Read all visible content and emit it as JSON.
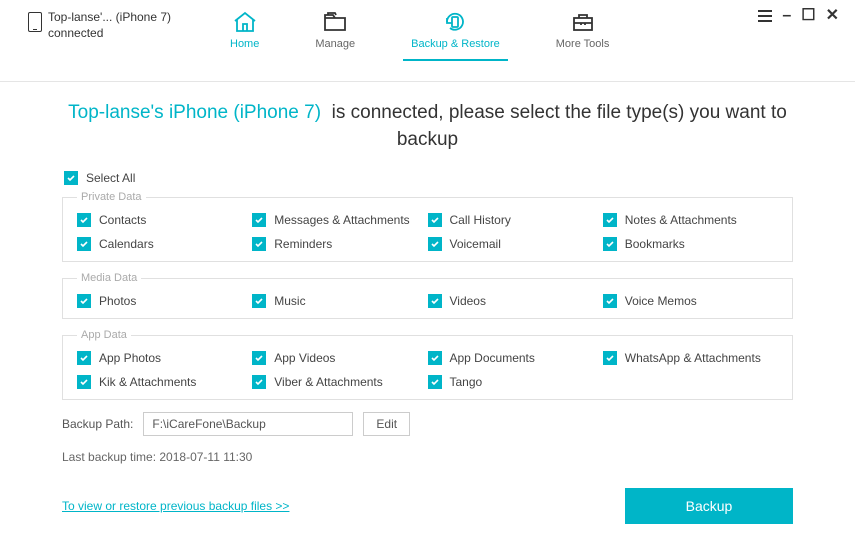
{
  "header": {
    "device_line1": "Top-lanse'... (iPhone 7)",
    "device_line2": "connected",
    "nav": {
      "home": "Home",
      "manage": "Manage",
      "backup": "Backup & Restore",
      "tools": "More Tools"
    }
  },
  "headline": {
    "device": "Top-lanse's iPhone (iPhone 7)",
    "rest": "is connected, please select the file type(s) you want to backup"
  },
  "select_all": "Select All",
  "sections": {
    "private": {
      "title": "Private Data",
      "items": [
        "Contacts",
        "Messages & Attachments",
        "Call History",
        "Notes & Attachments",
        "Calendars",
        "Reminders",
        "Voicemail",
        "Bookmarks"
      ]
    },
    "media": {
      "title": "Media Data",
      "items": [
        "Photos",
        "Music",
        "Videos",
        "Voice Memos"
      ]
    },
    "app": {
      "title": "App Data",
      "items": [
        "App Photos",
        "App Videos",
        "App Documents",
        "WhatsApp & Attachments",
        "Kik & Attachments",
        "Viber & Attachments",
        "Tango"
      ]
    }
  },
  "path": {
    "label": "Backup Path:",
    "value": "F:\\iCareFone\\Backup",
    "edit": "Edit"
  },
  "last_backup": "Last backup time: 2018-07-11 11:30",
  "view_link": "To view or restore previous backup files >>",
  "backup_btn": "Backup"
}
